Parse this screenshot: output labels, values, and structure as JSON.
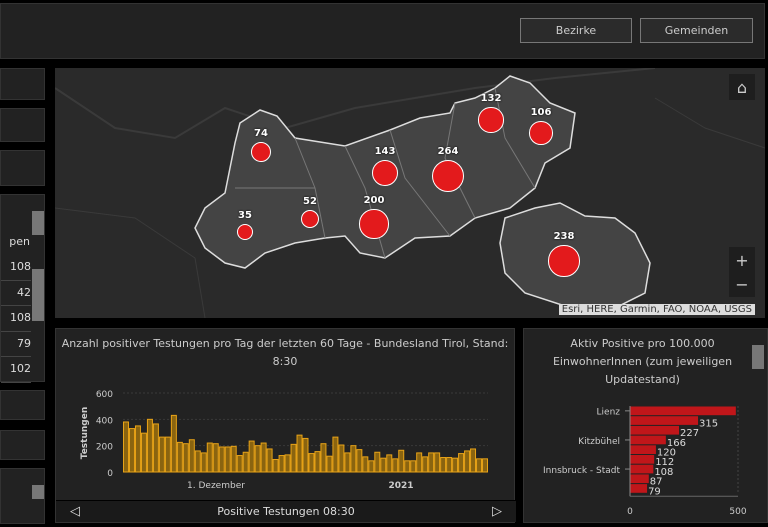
{
  "header": {
    "buttons": [
      "Bezirke",
      "Gemeinden"
    ]
  },
  "left_list": {
    "header_fragment": "pen",
    "values": [
      "108",
      "42",
      "108",
      "79",
      "102"
    ]
  },
  "map": {
    "attribution": "Esri, HERE, Garmin, FAO, NOAA, USGS",
    "controls": {
      "home": "⌂",
      "zoom_in": "+",
      "zoom_out": "−"
    },
    "bubble_color": "#e31a1c",
    "bubbles": [
      {
        "value": 74
      },
      {
        "value": 143
      },
      {
        "value": 264
      },
      {
        "value": 132
      },
      {
        "value": 106
      },
      {
        "value": 52
      },
      {
        "value": 200
      },
      {
        "value": 35
      },
      {
        "value": 238
      }
    ]
  },
  "chart_data": [
    {
      "type": "bar",
      "title": "Anzahl positiver Testungen pro Tag der letzten 60 Tage - Bundesland Tirol, Stand: 8:30",
      "ylabel": "Testungen",
      "ylim": [
        0,
        600
      ],
      "yticks": [
        0,
        200,
        400,
        600
      ],
      "xtick_labels": [
        "1. Dezember",
        "2021"
      ],
      "color": "#e8a317",
      "grid": true,
      "values": [
        380,
        330,
        350,
        295,
        400,
        365,
        265,
        265,
        430,
        225,
        215,
        245,
        160,
        145,
        220,
        215,
        190,
        190,
        195,
        125,
        150,
        235,
        200,
        220,
        175,
        95,
        125,
        130,
        210,
        280,
        255,
        140,
        155,
        215,
        120,
        265,
        205,
        145,
        200,
        170,
        115,
        85,
        150,
        105,
        130,
        100,
        165,
        85,
        85,
        145,
        115,
        145,
        145,
        110,
        110,
        105,
        140,
        160,
        175,
        100,
        100
      ]
    },
    {
      "type": "bar",
      "orientation": "horizontal",
      "title": "Aktiv Positive pro 100.000 EinwohnerInnen (zum jeweiligen Updatestand)",
      "categories": [
        "Lienz",
        "",
        "",
        "Kitzbühel",
        "",
        "",
        "Innsbruck - Stadt",
        "",
        ""
      ],
      "values": [
        490,
        315,
        227,
        166,
        120,
        112,
        108,
        87,
        79
      ],
      "data_labels": [
        "",
        "315",
        "227",
        "166",
        "120",
        "112",
        "108",
        "87",
        "79"
      ],
      "xlim": [
        0,
        500
      ],
      "xticks": [
        "0",
        "500"
      ],
      "color": "#c0161a"
    }
  ],
  "chart_footer": {
    "label": "Positive Testungen 08:30",
    "prev": "◁",
    "next": "▷"
  }
}
